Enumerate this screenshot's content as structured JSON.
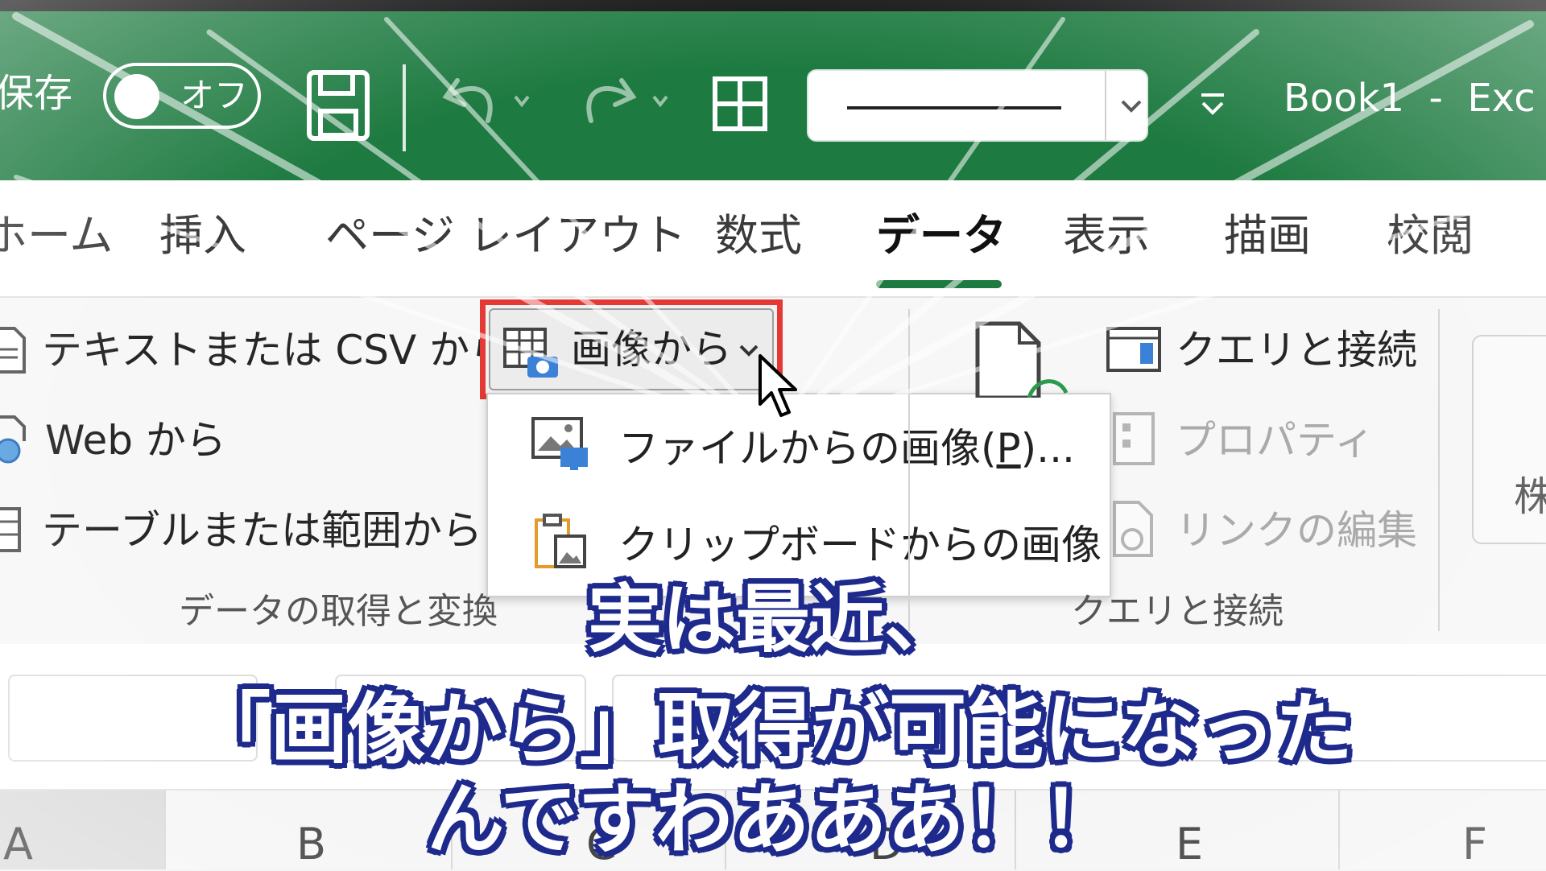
{
  "colors": {
    "excel_green": "#1d7a40",
    "highlight_red": "#e53935",
    "caption_outline": "#1e2a8c"
  },
  "titlebar": {
    "save_label": "保存",
    "autosave_state": "オフ",
    "save_icon": "floppy-disk-icon",
    "undo_icon": "undo-icon",
    "redo_icon": "redo-icon",
    "table_icon": "table-grid-icon",
    "customize_icon": "customize-toolbar-icon",
    "doc_title": "Book1  -  Exc"
  },
  "tabs": [
    {
      "label": "ホーム",
      "active": false
    },
    {
      "label": "挿入",
      "active": false
    },
    {
      "label": "ページ レイアウト",
      "active": false
    },
    {
      "label": "数式",
      "active": false
    },
    {
      "label": "データ",
      "active": true
    },
    {
      "label": "表示",
      "active": false
    },
    {
      "label": "描画",
      "active": false
    },
    {
      "label": "校閲",
      "active": false
    }
  ],
  "ribbon": {
    "get_data": {
      "from_text_csv": "テキストまたは CSV から",
      "from_web": "Web から",
      "from_table": "テーブルまたは範囲から",
      "group_label": "データの取得と変換"
    },
    "from_image_button": "画像から",
    "from_image_menu": [
      {
        "label_prefix": "ファイルからの画像(",
        "accel": "P",
        "label_suffix": ")...",
        "icon": "image-file-icon"
      },
      {
        "label": "クリップボードからの画像",
        "icon": "clipboard-image-icon"
      }
    ],
    "queries": {
      "queries_connections": "クエリと接続",
      "properties": "プロパティ",
      "edit_links": "リンクの編集",
      "group_label": "クエリと接続"
    },
    "stocks_partial": "株"
  },
  "columns": [
    "A",
    "B",
    "C",
    "D",
    "E",
    "F"
  ],
  "caption": {
    "line1": "実は最近、",
    "line2": "「画像から」取得が可能になった",
    "line3": "んですわあああ！！"
  }
}
